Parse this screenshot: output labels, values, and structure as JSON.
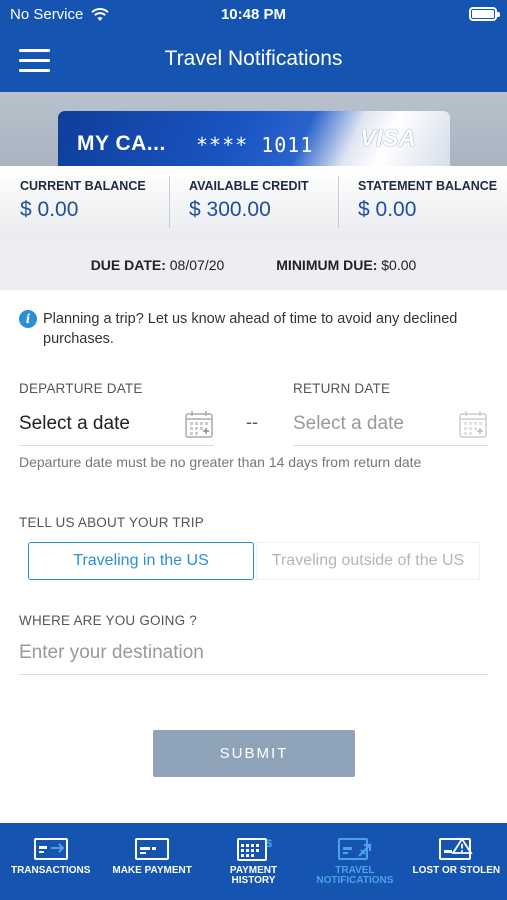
{
  "status_bar": {
    "carrier": "No Service",
    "time": "10:48 PM"
  },
  "header": {
    "title": "Travel Notifications"
  },
  "card": {
    "name": "MY CA...",
    "number": "**** 1011",
    "brand": "VISA"
  },
  "balances": [
    {
      "label": "CURRENT BALANCE",
      "value": "$ 0.00"
    },
    {
      "label": "AVAILABLE CREDIT",
      "value": "$ 300.00"
    },
    {
      "label": "STATEMENT BALANCE",
      "value": "$ 0.00"
    }
  ],
  "due": {
    "due_date_label": "DUE DATE:",
    "due_date": "08/07/20",
    "min_due_label": "MINIMUM DUE:",
    "min_due": "$0.00"
  },
  "info_text": "Planning a trip? Let us know ahead of time to avoid any declined purchases.",
  "departure": {
    "label": "DEPARTURE DATE",
    "value": "Select a date"
  },
  "separator": "--",
  "return": {
    "label": "RETURN DATE",
    "value": "Select a date"
  },
  "date_hint": "Departure date must be no greater than 14 days from return date",
  "trip": {
    "label": "TELL US ABOUT YOUR TRIP",
    "options": [
      "Traveling in the US",
      "Traveling outside of the US"
    ],
    "selected": "Traveling in the US"
  },
  "destination": {
    "label": "WHERE ARE YOU GOING ?",
    "placeholder": "Enter your destination"
  },
  "submit_label": "SUBMIT",
  "bottom_nav": [
    {
      "label": "TRANSACTIONS",
      "icon": "transactions-icon"
    },
    {
      "label": "MAKE PAYMENT",
      "icon": "card-icon"
    },
    {
      "label": "PAYMENT\nHISTORY",
      "icon": "calendar-dollar-icon"
    },
    {
      "label": "TRAVEL\nNOTIFICATIONS",
      "icon": "travel-card-icon",
      "active": true
    },
    {
      "label": "LOST OR STOLEN",
      "icon": "warning-card-icon"
    }
  ],
  "colors": {
    "brand_blue": "#1554b0",
    "accent": "#2a8fd6",
    "balance_value": "#1c4f9e",
    "submit_disabled": "#8ea3b8"
  }
}
